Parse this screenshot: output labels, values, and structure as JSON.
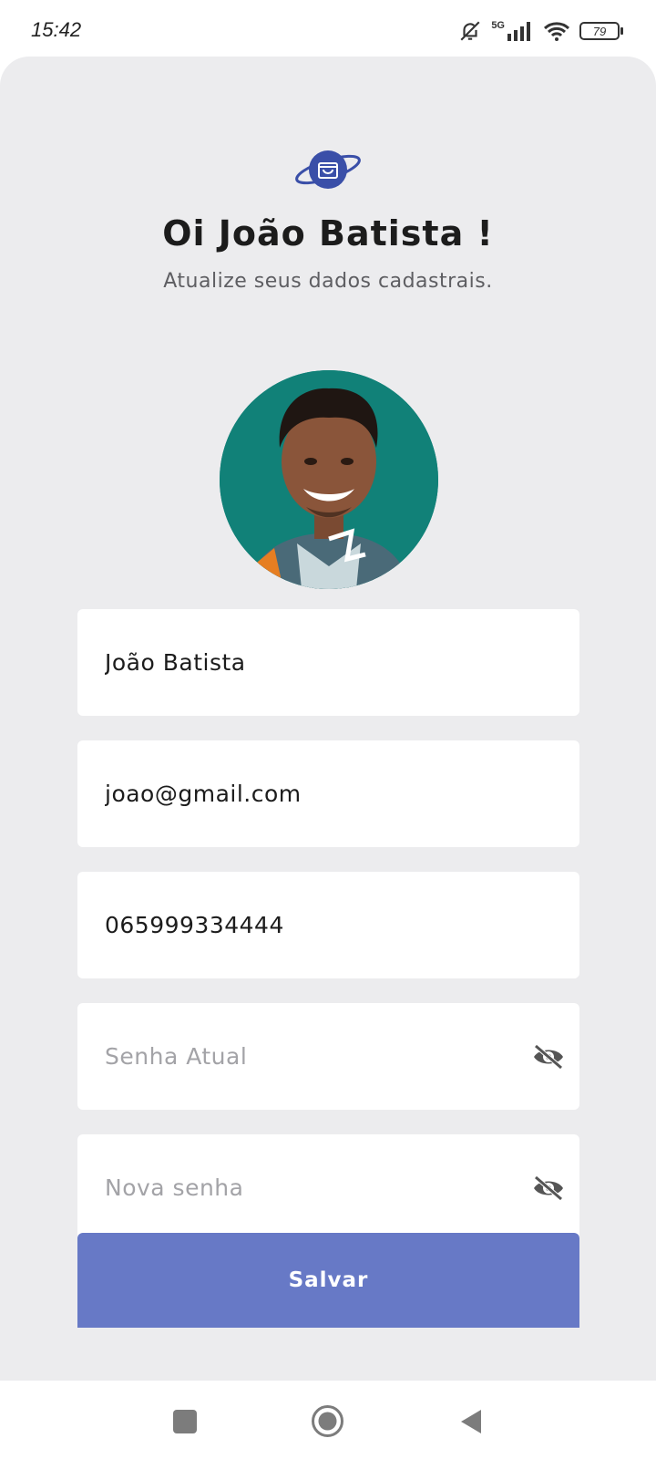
{
  "status_bar": {
    "time": "15:42",
    "network": "5G",
    "battery": "79",
    "icons": [
      "bell-off-icon",
      "signal-icon",
      "wifi-icon",
      "battery-icon"
    ]
  },
  "header": {
    "logo_icon": "shopping-bag-planet-icon",
    "greeting": "Oi João Batista !",
    "subtitle": "Atualize seus dados cadastrais."
  },
  "profile": {
    "avatar_icon": "user-photo"
  },
  "form": {
    "name_value": "João Batista",
    "email_value": "joao@gmail.com",
    "phone_value": "065999334444",
    "current_password_placeholder": "Senha Atual",
    "new_password_placeholder": "Nova senha",
    "save_label": "Salvar"
  },
  "colors": {
    "accent": "#6779c6",
    "logo": "#3a4fa8",
    "background": "#ececee",
    "avatar_bg": "#118178"
  },
  "nav": {
    "icons": [
      "recents-square-icon",
      "home-circle-icon",
      "back-triangle-icon"
    ]
  }
}
